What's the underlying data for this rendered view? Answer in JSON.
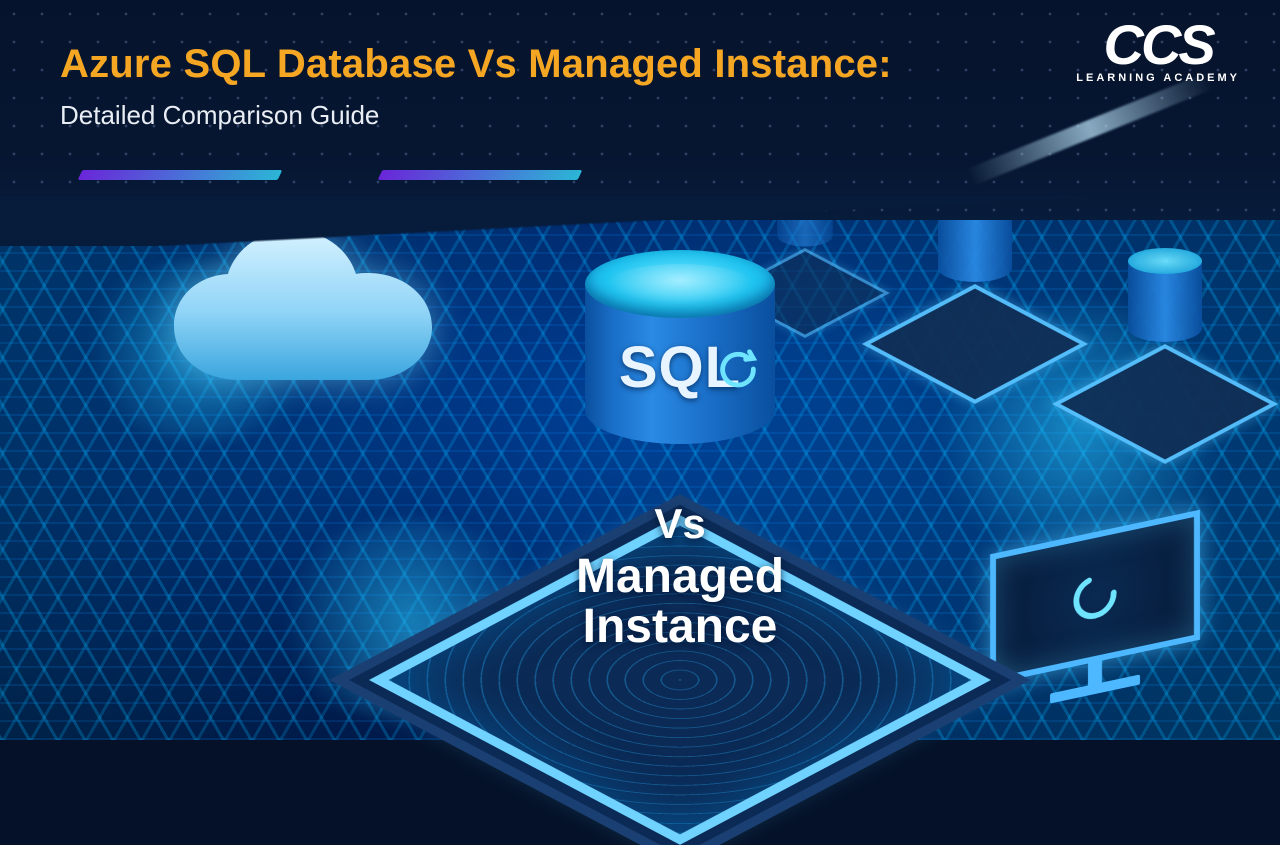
{
  "header": {
    "title": "Azure SQL Database Vs Managed Instance:",
    "subtitle": "Detailed Comparison Guide"
  },
  "logo": {
    "main": "CCS",
    "sub": "LEARNING ACADEMY"
  },
  "hero": {
    "db_label": "SQL",
    "vs_label": "Vs",
    "managed_line1": "Managed",
    "managed_line2": "Instance"
  },
  "colors": {
    "title": "#f5a623",
    "accent_start": "#6a26d9",
    "accent_end": "#2bb6d6",
    "glow": "#4db8ff"
  }
}
